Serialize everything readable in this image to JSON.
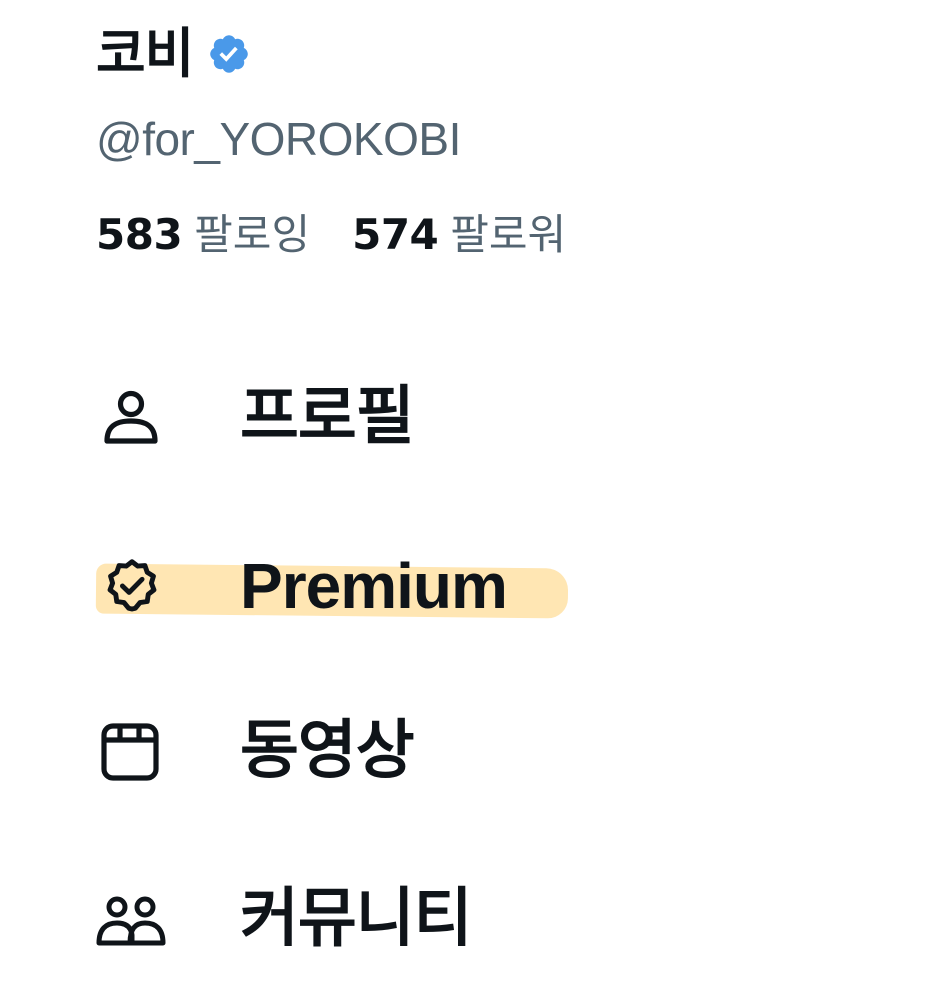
{
  "profile": {
    "display_name": "코비",
    "handle": "@for_YOROKOBI",
    "verified_icon": "verified-badge-icon",
    "verified_color": "#4a99e9",
    "following_count": "583",
    "following_label": "팔로잉",
    "followers_count": "574",
    "followers_label": "팔로워"
  },
  "menu": {
    "items": [
      {
        "id": "profile",
        "label": "프로필",
        "icon": "person-icon"
      },
      {
        "id": "premium",
        "label": "Premium",
        "icon": "premium-badge-icon"
      },
      {
        "id": "videos",
        "label": "동영상",
        "icon": "video-icon"
      },
      {
        "id": "communities",
        "label": "커뮤니티",
        "icon": "communities-icon"
      }
    ]
  },
  "colors": {
    "text_primary": "#0f1419",
    "text_secondary": "#536471",
    "highlight": "#ffe6b3"
  }
}
